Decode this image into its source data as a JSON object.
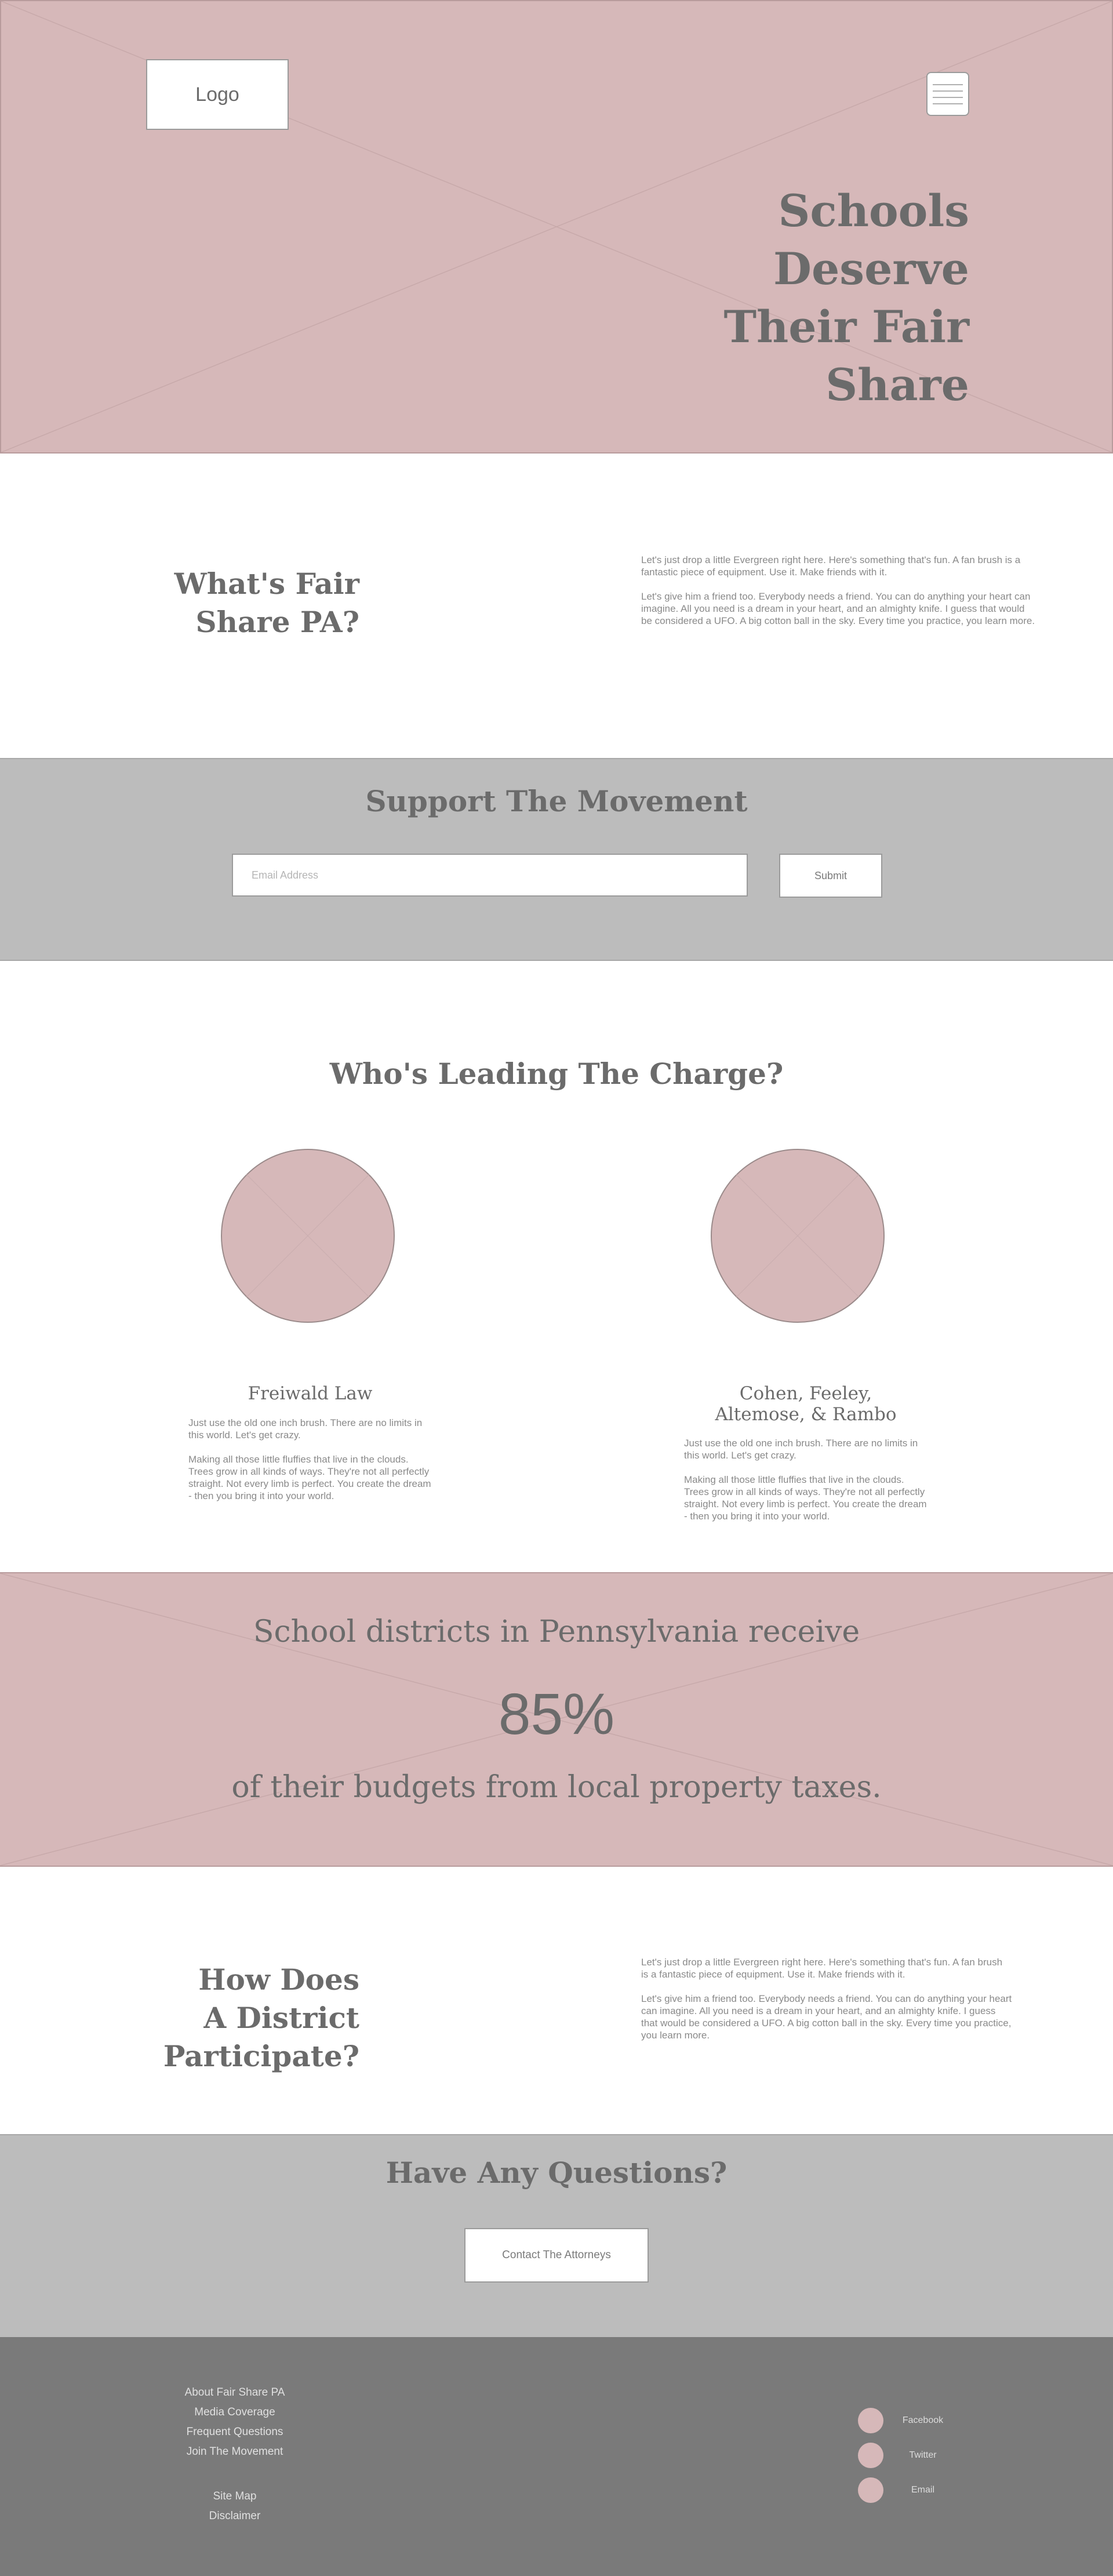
{
  "hero": {
    "logo_text": "Logo",
    "title_line1": "Schools Deserve",
    "title_line2": "Their Fair Share"
  },
  "about": {
    "title_line1": "What's Fair",
    "title_line2": "Share PA?",
    "paragraph1": "Let's just drop a little Evergreen right here. Here's something that's fun. A fan brush is a fantastic piece of equipment. Use it. Make friends with it.",
    "paragraph2": "Let's give him a friend too. Everybody needs a friend. You can do anything your heart can imagine. All you need is a dream in your heart, and an almighty knife. I guess that would be considered a UFO. A big cotton ball in the sky. Every time you practice, you learn more."
  },
  "support": {
    "title": "Support The Movement",
    "email_placeholder": "Email Address",
    "submit_label": "Submit"
  },
  "leaders": {
    "title": "Who's Leading The Charge?",
    "items": [
      {
        "name_line1": "Freiwald Law",
        "name_line2": "",
        "bio1": "Just use the old one inch brush. There are no limits in this world. Let's get crazy.",
        "bio2": "Making all those little fluffies that live in the clouds. Trees grow in all kinds of ways. They're not all perfectly straight. Not every limb is perfect. You create the dream - then you bring it into your world."
      },
      {
        "name_line1": "Cohen, Feeley,",
        "name_line2": "Altemose, & Rambo",
        "bio1": "Just use the old one inch brush. There are no limits in this world. Let's get crazy.",
        "bio2": "Making all those little fluffies that live in the clouds. Trees grow in all kinds of ways. They're not all perfectly straight. Not every limb is perfect. You create the dream - then you bring it into your world."
      }
    ]
  },
  "stat": {
    "top_text": "School districts in Pennsylvania receive",
    "value": "85%",
    "bottom_text": "of their budgets from local property taxes."
  },
  "how": {
    "title_line1": "How Does",
    "title_line2": "A District",
    "title_line3": "Participate?",
    "paragraph1": "Let's just drop a little Evergreen right here.  Here's something that's fun. A fan brush is a fantastic piece of equipment. Use it. Make friends with it.",
    "paragraph2": "Let's give him a friend too. Everybody needs a friend. You can do anything your heart can imagine. All you need is a dream in your heart, and an almighty knife. I guess that would be considered a UFO. A big cotton ball in the sky. Every time you practice, you learn more."
  },
  "questions": {
    "title": "Have Any Questions?",
    "contact_label": "Contact The Attorneys"
  },
  "footer": {
    "links_primary": [
      "About Fair Share PA",
      "Media Coverage",
      "Frequent Questions",
      "Join The Movement"
    ],
    "links_secondary": [
      "Site Map",
      "Disclaimer"
    ],
    "social": [
      {
        "label": "Facebook",
        "icon": "facebook-icon"
      },
      {
        "label": "Twitter",
        "icon": "twitter-icon"
      },
      {
        "label": "Email",
        "icon": "email-icon"
      }
    ]
  },
  "colors": {
    "pink_block": "#d6b8b9",
    "gray_block": "#bcbcbc",
    "footer_bg": "#7a7a7a",
    "heading_text": "#6b6b6b"
  }
}
